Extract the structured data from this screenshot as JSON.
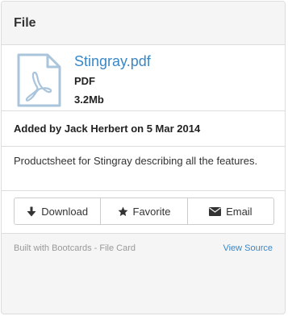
{
  "card": {
    "heading": "File",
    "file": {
      "icon": "pdf-file-icon",
      "name": "Stingray.pdf",
      "type": "PDF",
      "size": "3.2Mb"
    },
    "added_by": "Added by Jack Herbert on 5 Mar 2014",
    "description": "Productsheet for Stingray describing all the features.",
    "actions": [
      {
        "label": "Download",
        "icon": "download-icon"
      },
      {
        "label": "Favorite",
        "icon": "star-icon"
      },
      {
        "label": "Email",
        "icon": "envelope-icon"
      }
    ],
    "footer": {
      "note": "Built with Bootcards - File Card",
      "link": "View Source"
    }
  },
  "colors": {
    "link": "#3a87c7",
    "icon": "#aac4dc",
    "border": "#dddddd",
    "muted": "#999999"
  }
}
